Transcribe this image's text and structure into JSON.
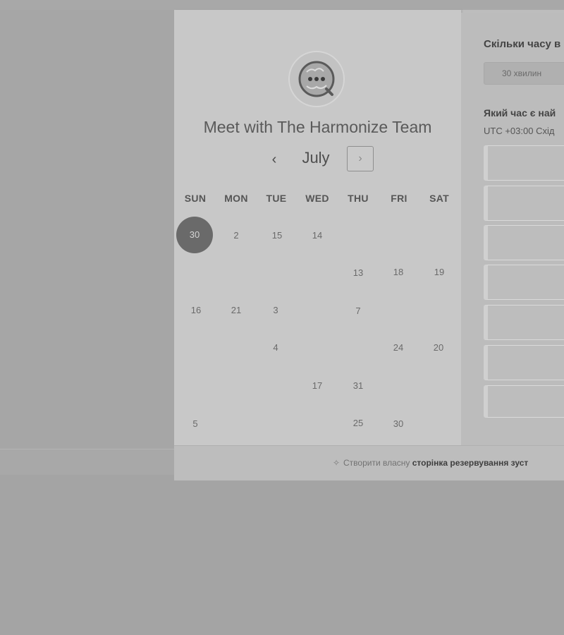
{
  "page": {
    "title": "Meet with The Harmonize Team",
    "month": "July",
    "prev_icon": "chevron-left-icon",
    "next_icon": "chevron-right-icon"
  },
  "weekdays": [
    "SUN",
    "MON",
    "TUE",
    "WED",
    "THU",
    "FRI",
    "SAT"
  ],
  "calendar_days": [
    {
      "label": "30",
      "selected": true
    },
    {
      "label": "2"
    },
    {
      "label": "15"
    },
    {
      "label": "14"
    },
    {
      "label": "13"
    },
    {
      "label": "18"
    },
    {
      "label": "19"
    },
    {
      "label": "16"
    },
    {
      "label": "21"
    },
    {
      "label": "3"
    },
    {
      "label": "7"
    },
    {
      "label": "4"
    },
    {
      "label": "24"
    },
    {
      "label": "20"
    },
    {
      "label": "17"
    },
    {
      "label": "31"
    },
    {
      "label": "5"
    },
    {
      "label": "25"
    },
    {
      "label": "30"
    }
  ],
  "right_panel": {
    "duration_question": "Скільки часу в",
    "duration_option": "30 хвилин",
    "time_question": "Який час є най",
    "timezone": "UTC +03:00 Схід",
    "time_slots": [
      "",
      "",
      "",
      "",
      "",
      "",
      ""
    ]
  },
  "footer": {
    "prefix": "Створити власну",
    "link": "сторінка резервування зуст"
  },
  "colors": {
    "selected_day": "#6a6a6a",
    "calendar_bg": "#c8c8c8",
    "page_bg": "#a4a4a4"
  }
}
